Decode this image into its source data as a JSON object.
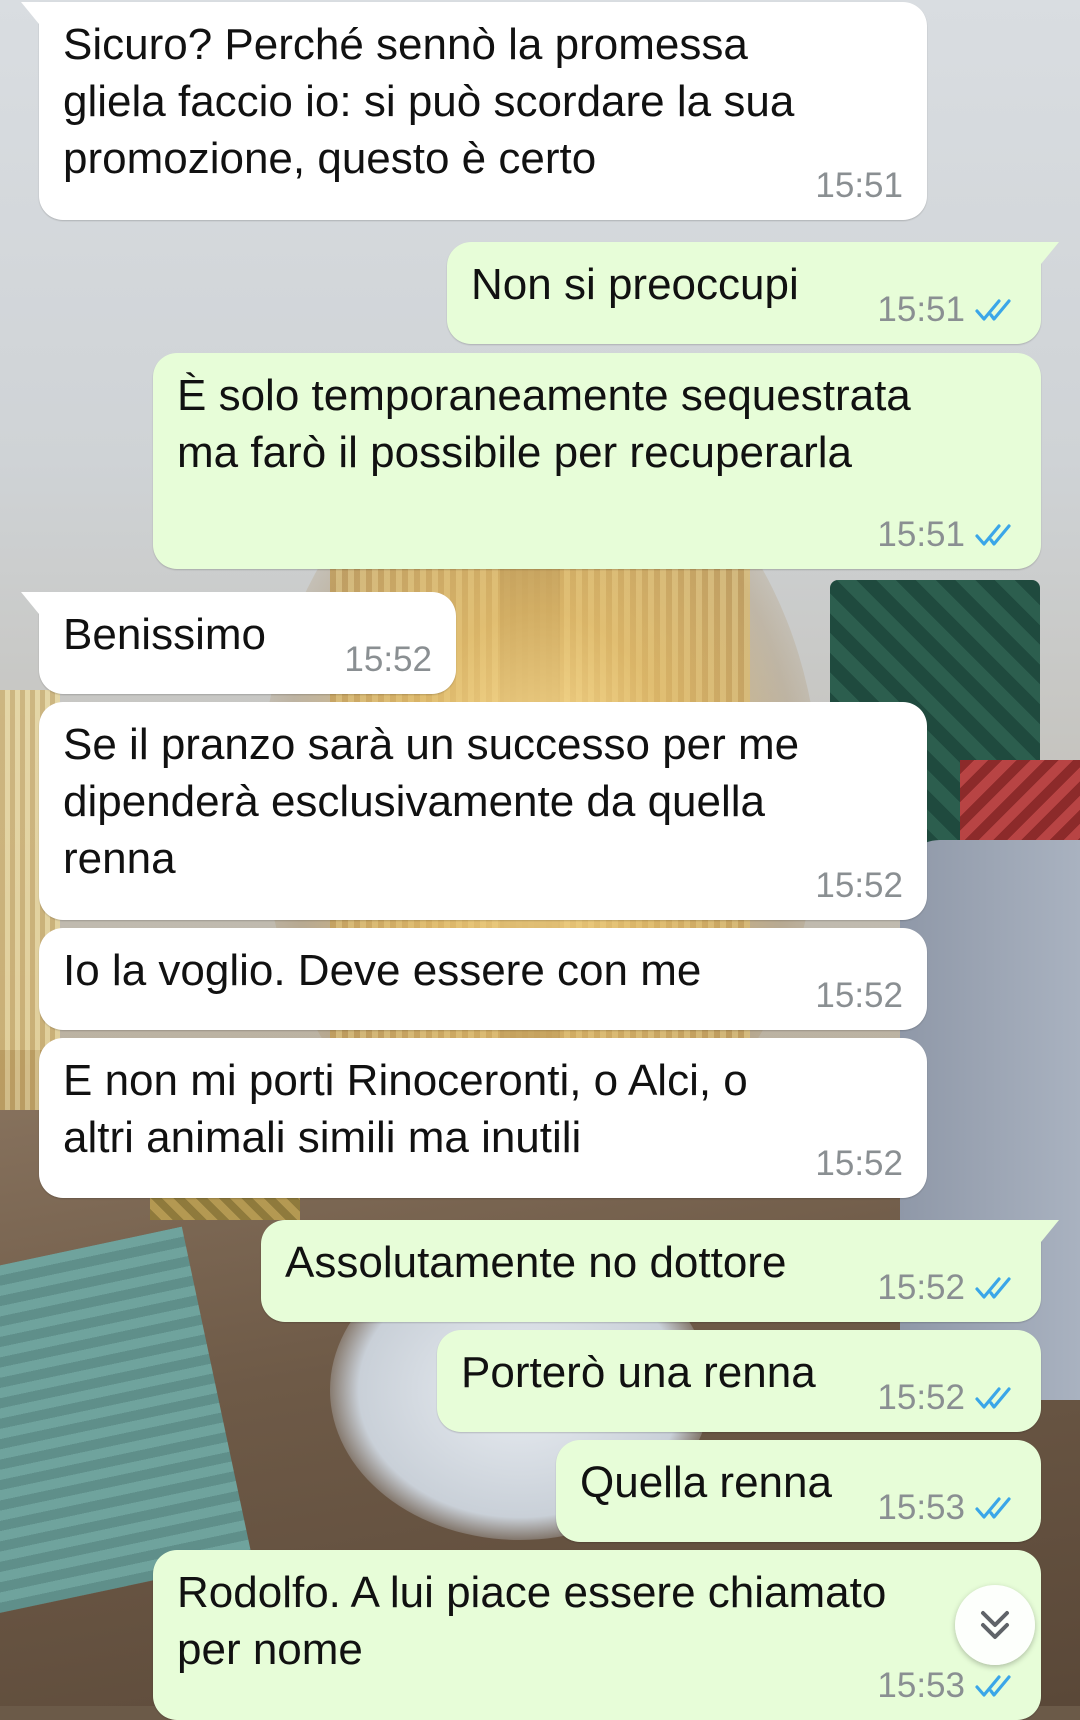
{
  "colors": {
    "incoming_bubble": "#ffffff",
    "outgoing_bubble": "#e7fdd8",
    "timestamp": "#8a8f92",
    "read_ticks": "#3ba6e8"
  },
  "messages": [
    {
      "direction": "in",
      "text": "Sicuro? Perché sennò la promessa\ngliela faccio io: si può scordare la sua\npromozione, questo è certo",
      "time": "15:51"
    },
    {
      "direction": "out",
      "text": "Non si preoccupi",
      "time": "15:51",
      "status": "read"
    },
    {
      "direction": "out",
      "text": "È solo temporaneamente sequestrata\nma farò il possibile per recuperarla",
      "time": "15:51",
      "status": "read"
    },
    {
      "direction": "in",
      "text": "Benissimo",
      "time": "15:52"
    },
    {
      "direction": "in",
      "text": "Se il pranzo sarà un successo per me\ndipenderà esclusivamente da quella\nrenna",
      "time": "15:52"
    },
    {
      "direction": "in",
      "text": "Io la voglio. Deve essere con me",
      "time": "15:52"
    },
    {
      "direction": "in",
      "text": "E non mi porti Rinoceronti, o Alci, o\naltri animali simili ma inutili",
      "time": "15:52"
    },
    {
      "direction": "out",
      "text": "Assolutamente no dottore",
      "time": "15:52",
      "status": "read"
    },
    {
      "direction": "out",
      "text": "Porterò una renna",
      "time": "15:52",
      "status": "read"
    },
    {
      "direction": "out",
      "text": "Quella renna",
      "time": "15:53",
      "status": "read"
    },
    {
      "direction": "out",
      "text": "Rodolfo. A lui piace essere chiamato\nper nome",
      "time": "15:53",
      "status": "read"
    }
  ],
  "scroll_button": {
    "icon": "double-chevron-down-icon"
  }
}
